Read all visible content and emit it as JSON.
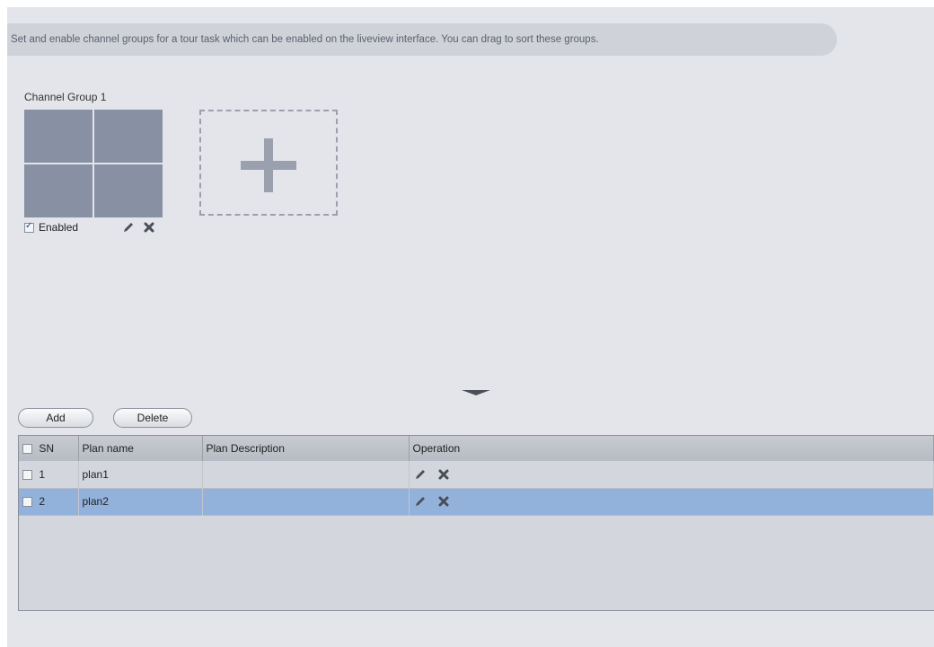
{
  "tip": {
    "text": "Set and enable channel groups for a tour task which can be enabled on the liveview interface. You can drag to sort these groups."
  },
  "channel_group": {
    "title": "Channel Group 1",
    "enabled_label": "Enabled",
    "enabled": true,
    "edit_icon": "pencil-icon",
    "delete_icon": "close-icon"
  },
  "add_group_icon": "plus-icon",
  "collapse_icon": "triangle-down-icon",
  "toolbar": {
    "add_label": "Add",
    "delete_label": "Delete"
  },
  "table": {
    "columns": {
      "sn": "SN",
      "name": "Plan name",
      "description": "Plan Description",
      "operation": "Operation"
    },
    "rows": [
      {
        "sn": "1",
        "name": "plan1",
        "description": "",
        "selected": false
      },
      {
        "sn": "2",
        "name": "plan2",
        "description": "",
        "selected": true
      }
    ]
  },
  "colors": {
    "panel_bg": "#e3e5ea",
    "thumb": "#8890a3",
    "selected_row": "#92b2dc",
    "icon": "#4a4e58"
  }
}
